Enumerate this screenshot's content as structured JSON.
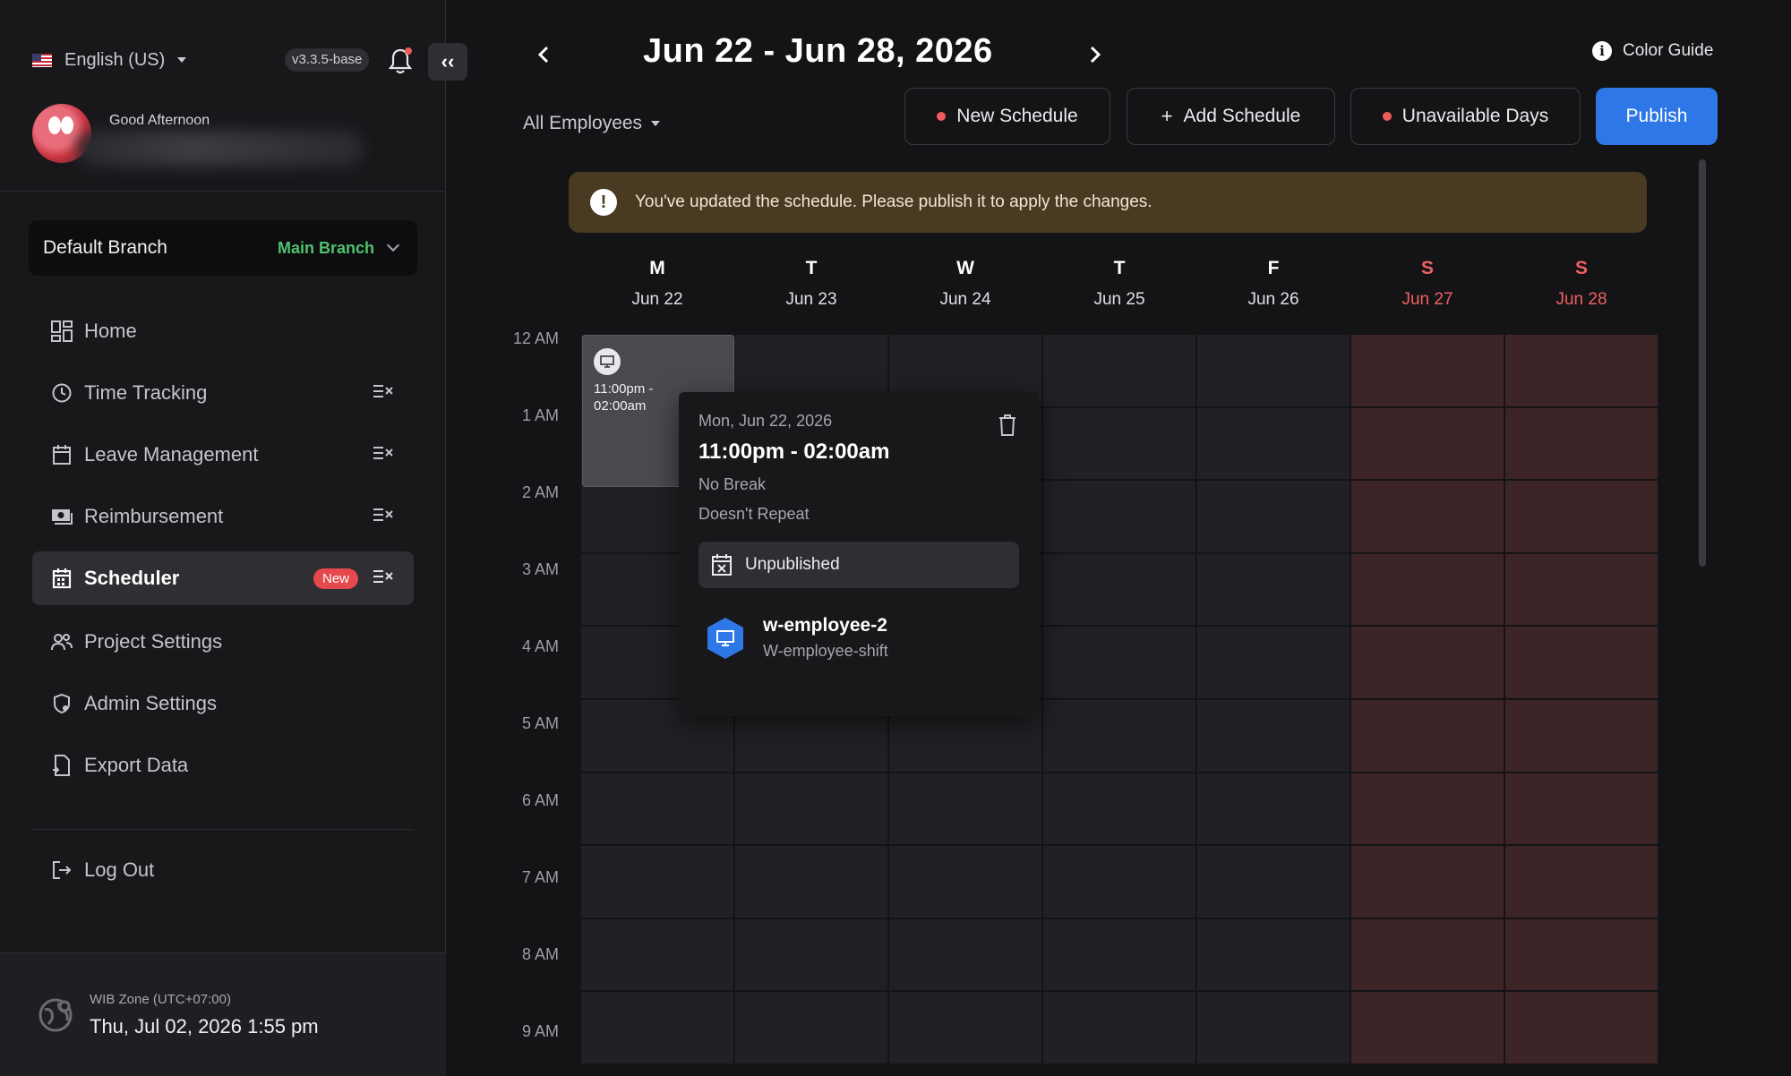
{
  "sidebar": {
    "language": "English (US)",
    "version": "v3.3.5-base",
    "greeting": "Good Afternoon",
    "branch": {
      "label": "Default Branch",
      "value": "Main Branch"
    },
    "nav": [
      {
        "label": "Home",
        "icon": "dashboard-icon"
      },
      {
        "label": "Time Tracking",
        "icon": "clock-icon"
      },
      {
        "label": "Leave Management",
        "icon": "calendar-icon"
      },
      {
        "label": "Reimbursement",
        "icon": "money-icon"
      },
      {
        "label": "Scheduler",
        "icon": "calendar-icon",
        "badge": "New",
        "active": true
      },
      {
        "label": "Project Settings",
        "icon": "users-icon"
      },
      {
        "label": "Admin Settings",
        "icon": "shield-icon"
      },
      {
        "label": "Export Data",
        "icon": "export-icon"
      }
    ],
    "logout": "Log Out",
    "timezone": {
      "label": "WIB Zone (UTC+07:00)",
      "datetime": "Thu, Jul 02, 2026 1:55 pm"
    }
  },
  "header": {
    "range_title": "Jun 22 - Jun 28, 2026",
    "color_guide": "Color Guide",
    "employee_filter": "All Employees",
    "buttons": {
      "new_schedule": "New Schedule",
      "add_schedule": "Add Schedule",
      "unavailable_days": "Unavailable Days",
      "publish": "Publish"
    }
  },
  "alert": {
    "message": "You've updated the schedule. Please publish it to apply the changes."
  },
  "calendar": {
    "days": [
      {
        "letter": "M",
        "date": "Jun 22",
        "weekend": false
      },
      {
        "letter": "T",
        "date": "Jun 23",
        "weekend": false
      },
      {
        "letter": "W",
        "date": "Jun 24",
        "weekend": false
      },
      {
        "letter": "T",
        "date": "Jun 25",
        "weekend": false
      },
      {
        "letter": "F",
        "date": "Jun 26",
        "weekend": false
      },
      {
        "letter": "S",
        "date": "Jun 27",
        "weekend": true
      },
      {
        "letter": "S",
        "date": "Jun 28",
        "weekend": true
      }
    ],
    "hours": [
      "12 AM",
      "1 AM",
      "2 AM",
      "3 AM",
      "4 AM",
      "5 AM",
      "6 AM",
      "7 AM",
      "8 AM",
      "9 AM"
    ],
    "shift_block": {
      "time": "11:00pm - 02:00am"
    }
  },
  "popover": {
    "date": "Mon, Jun 22, 2026",
    "time": "11:00pm - 02:00am",
    "break": "No Break",
    "repeat": "Doesn't Repeat",
    "status": "Unpublished",
    "employee": {
      "name": "w-employee-2",
      "shift": "W-employee-shift"
    }
  },
  "colors": {
    "accent": "#2e77e6",
    "weekend_text": "#ef6161",
    "weekend_cell": "#3d2426",
    "branch_green": "#4fc26f",
    "alert_bg": "#4a3a22"
  }
}
